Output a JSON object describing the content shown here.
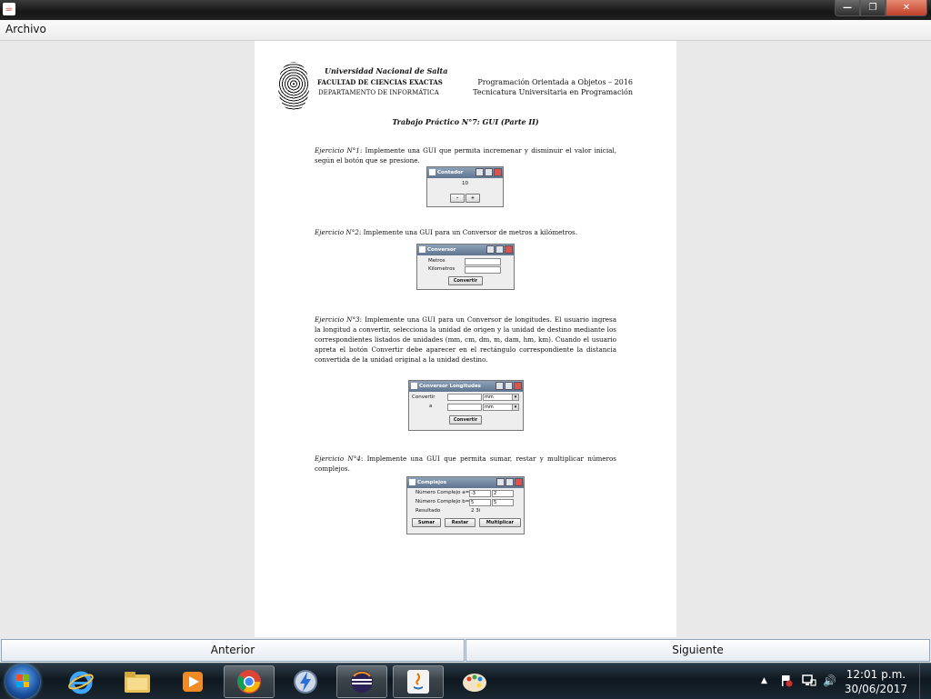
{
  "window": {
    "close_glyph": "✕",
    "min_glyph": "—",
    "max_glyph": "❐",
    "app_icon": "java-icon"
  },
  "menubar": {
    "archivo": "Archivo"
  },
  "doc": {
    "uni": "Universidad Nacional de Salta",
    "facultad": "FACULTAD DE CIENCIAS EXACTAS",
    "depto": "DEPARTAMENTO DE INFORMÁTICA",
    "course": "Programación Orientada a Objetos – 2016",
    "career": "Tecnicatura Universitaria en Programación",
    "title": "Trabajo Práctico N°7: GUI (Parte II)",
    "ej1_label": "Ejercicio N°1",
    "ej1_text": ": Implemente una GUI que permita incremenar y disminuir el valor inicial, según el botón que se presione.",
    "ej2_label": "Ejercicio N°2",
    "ej2_text": ": Implemente una GUI para un Conversor de metros a kilómetros.",
    "ej3_label": "Ejercicio N°3",
    "ej3_text": ": Implemente una GUI para un Conversor de longitudes. El usuario ingresa la longitud a convertir, selecciona la unidad de origen y la unidad de destino mediante los correspondientes listados de unidades (mm, cm, dm, m, dam, hm, km). Cuando el usuario apreta el botón Convertir debe aparecer en el rectángulo correspondiente la distancia convertida de la unidad original a la unidad destino.",
    "ej4_label": "Ejercicio N°4",
    "ej4_text": ": Implemente una GUI que permita sumar, restar y multiplicar números complejos."
  },
  "win_contador": {
    "title": "Contador",
    "value": "10",
    "btn_minus": "-",
    "btn_plus": "+"
  },
  "win_conversor": {
    "title": "Conversor",
    "metros": "Metros",
    "kilometros": "Kilometros",
    "convertir": "Convertir"
  },
  "win_longitudes": {
    "title": "Conversor Longitudes",
    "convertir_lbl": "Convertir",
    "a_lbl": "a",
    "unit1": "mm",
    "unit2": "mm",
    "convertir_btn": "Convertir"
  },
  "win_complejos": {
    "title": "Complejos",
    "c1_label": "Número Complejo a=",
    "c1_re": "-3",
    "c1_im": "2",
    "c2_label": "Número Complejo b=",
    "c2_re": "5",
    "c2_im": "5",
    "res_label": "Resultado",
    "res_value": "2 3i",
    "btn_sumar": "Sumar",
    "btn_restar": "Restar",
    "btn_multiplicar": "Multiplicar"
  },
  "nav": {
    "anterior": "Anterior",
    "siguiente": "Siguiente"
  },
  "taskbar": {
    "time": "12:01 p.m.",
    "date": "30/06/2017",
    "tray_arrow": "▲",
    "volume": "🔊"
  }
}
